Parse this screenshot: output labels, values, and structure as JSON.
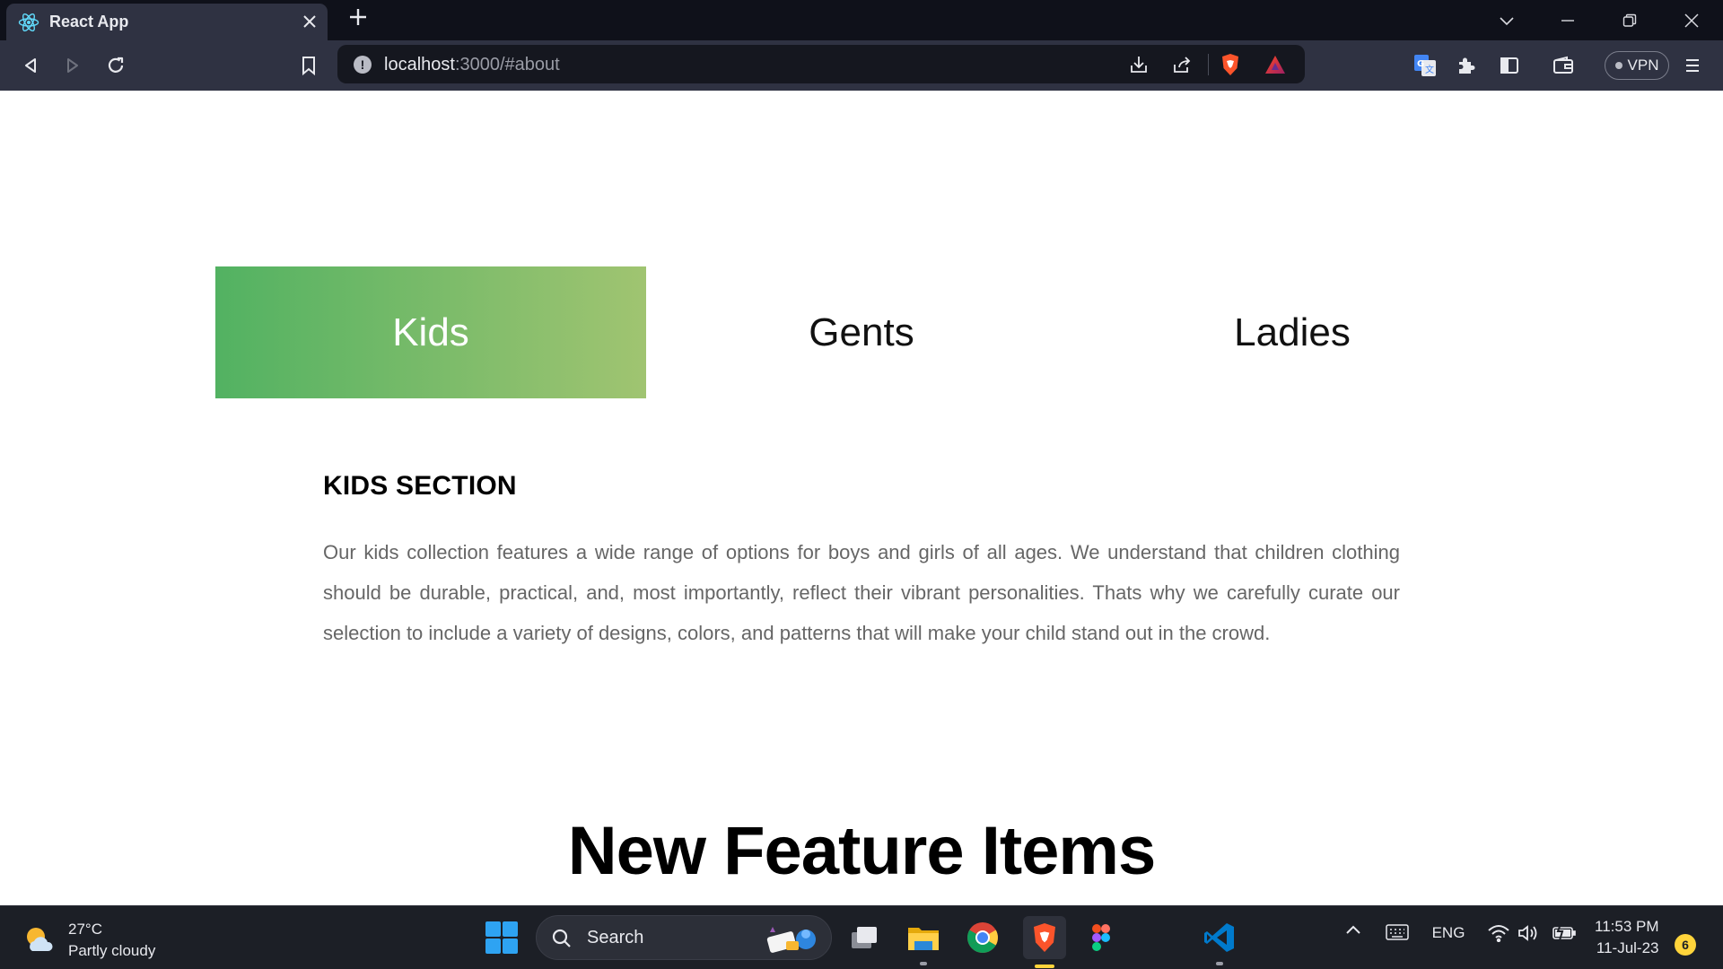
{
  "browser": {
    "tab_title": "React App",
    "url_host": "localhost",
    "url_rest": ":3000/#about",
    "vpn_label": "VPN"
  },
  "page": {
    "tabs": [
      {
        "label": "Kids",
        "active": true
      },
      {
        "label": "Gents",
        "active": false
      },
      {
        "label": "Ladies",
        "active": false
      }
    ],
    "section_heading": "KIDS SECTION",
    "section_text": "Our kids collection features a wide range of options for boys and girls of all ages. We understand that children clothing should be durable, practical, and, most importantly, reflect their vibrant personalities. Thats why we carefully curate our selection to include a variety of designs, colors, and patterns that will make your child stand out in the crowd.",
    "feature_title": "New Feature Items",
    "active_gradient": [
      "#52b262",
      "#a0c471"
    ]
  },
  "taskbar": {
    "weather_temp": "27°C",
    "weather_desc": "Partly cloudy",
    "search_label": "Search",
    "language": "ENG",
    "time": "11:53 PM",
    "date": "11-Jul-23",
    "notification_count": "6"
  }
}
